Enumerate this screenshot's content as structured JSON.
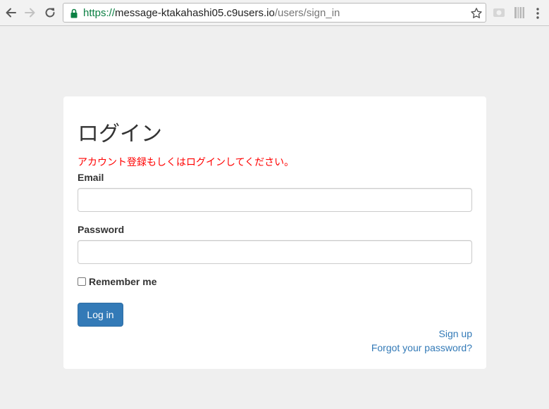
{
  "browser": {
    "url_scheme": "https://",
    "url_host": "message-ktakahashi05.c9users.io",
    "url_path": "/users/sign_in",
    "icons": {
      "back": "arrow-left-icon",
      "forward": "arrow-right-icon",
      "reload": "reload-icon",
      "secure": "lock-icon",
      "bookmark": "star-icon",
      "extension1": "extension-icon",
      "extension2": "barcode-icon",
      "menu": "kebab-menu-icon"
    },
    "secure_color": "#0b8043"
  },
  "login": {
    "title": "ログイン",
    "alert": "アカウント登録もしくはログインしてください。",
    "alert_color": "#ff0000",
    "email_label": "Email",
    "email_value": "",
    "password_label": "Password",
    "password_value": "",
    "remember_label": "Remember me",
    "remember_checked": false,
    "submit_label": "Log in",
    "signup_link": "Sign up",
    "forgot_link": "Forgot your password?",
    "accent_color": "#337ab7"
  }
}
